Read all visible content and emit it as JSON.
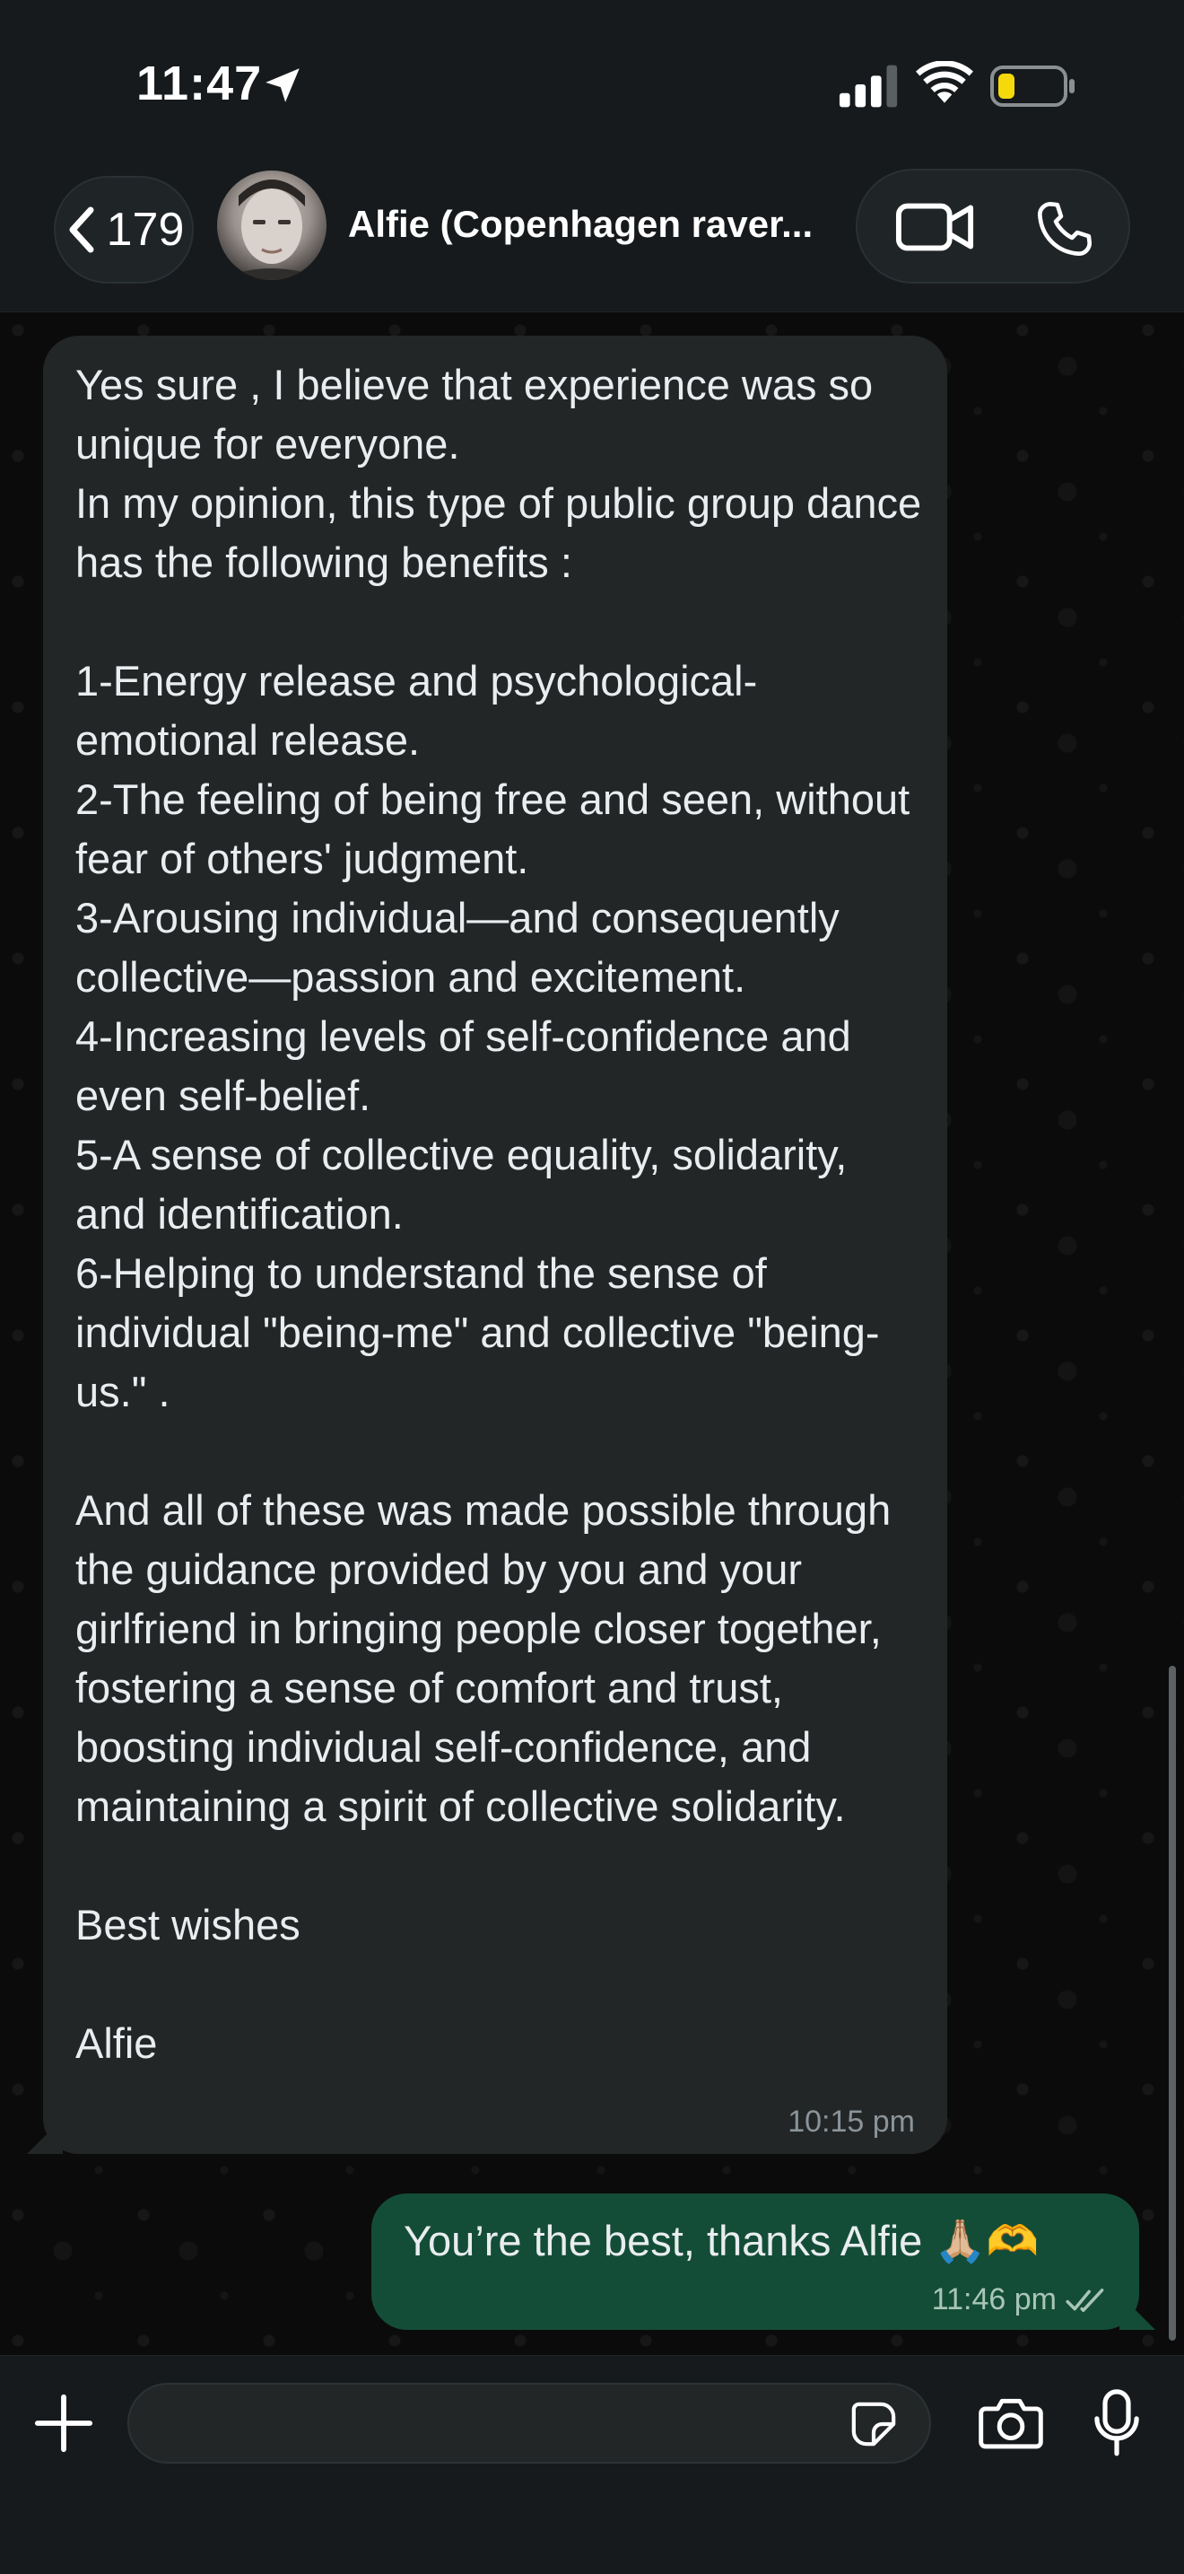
{
  "status_bar": {
    "time": "11:47"
  },
  "header": {
    "back_count": "179",
    "contact_name": "Alfie (Copenhagen raver..."
  },
  "messages": [
    {
      "direction": "incoming",
      "text": "Yes sure , I believe that experience was so unique for everyone.\nIn my opinion, this type of public group dance has the following benefits :\n\n1-Energy release and psychological-emotional release.\n2-The feeling of being free and seen, without fear of others' judgment.\n3-Arousing individual—and consequently collective—passion and excitement.\n4-Increasing levels of self-confidence and even self-belief.\n5-A sense of collective equality, solidarity, and identification.\n6-Helping to understand the sense of individual \"being-me\" and collective \"being-us.\" .\n\nAnd all of these was made possible through the guidance provided by you and your girlfriend in bringing people closer together, fostering a sense of comfort and trust, boosting individual self-confidence, and maintaining a spirit of collective solidarity.\n\nBest wishes\n\nAlfie",
      "time": "10:15 pm"
    },
    {
      "direction": "outgoing",
      "text": "You’re the best, thanks Alfie 🙏🏼🫶",
      "time": "11:46 pm"
    }
  ],
  "composer": {
    "value": "",
    "placeholder": ""
  },
  "colors": {
    "incoming_bubble": "#232627",
    "outgoing_bubble": "#144d37",
    "header_bg": "#161a1c",
    "battery_low": "#f5d90a"
  }
}
